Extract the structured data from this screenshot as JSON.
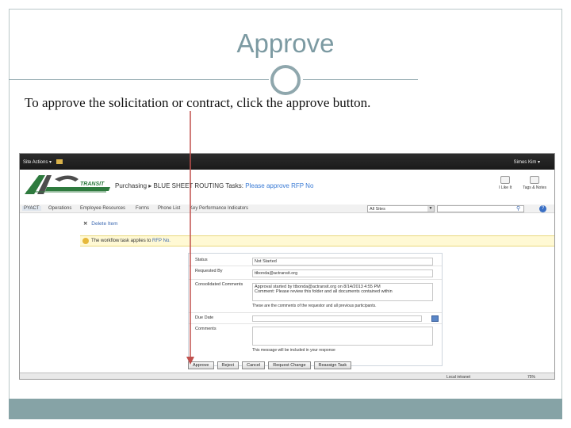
{
  "slide": {
    "title": "Approve",
    "body": "To approve the solicitation or contract, click the approve button."
  },
  "colors": {
    "title": "#7c9aa2",
    "footer": "#86a3a6",
    "arrow": "#c0504d",
    "ribbon": "#1f1f1f",
    "link": "#3a67b0",
    "info_bar": "#fff9d4"
  },
  "screenshot": {
    "ribbon": {
      "site_actions": "Site Actions ▾",
      "user": "Simes Kim ▾"
    },
    "header": {
      "logo_text": "TRANSIT",
      "breadcrumb_site": "Purchasing",
      "breadcrumb_sep": "▸",
      "breadcrumb_list": "BLUE SHEET ROUTING Tasks:",
      "breadcrumb_item": "Please approve RFP No",
      "actions": [
        "I Like It",
        "Tags & Notes"
      ]
    },
    "topnav": {
      "items": [
        "PYACT",
        "Operations",
        "Employee Resources",
        "Forms",
        "Phone List",
        "Key Performance Indicators"
      ],
      "search_scope": "All Sites"
    },
    "toolbar": {
      "delete_label": "Delete Item"
    },
    "info_bar": {
      "text": "The workflow task applies to",
      "link": "RFP No."
    },
    "form": {
      "status_label": "Status",
      "status_value": "Not Started",
      "requested_by_label": "Requested By",
      "requested_by_value": "ttbonda@actransit.org",
      "comments_label": "Consolidated Comments",
      "comments_value_1": "Approval started by ttbonda@actransit.org on 8/14/2013 4:55 PM",
      "comments_value_2": "Comment: Please review this folder and all documents contained within",
      "comments_note": "These are the comments of the requestor and all previous participants.",
      "due_date_label": "Due Date",
      "comments_field_label": "Comments",
      "comments_field_note": "This message will be included in your response"
    },
    "buttons": {
      "approve": "Approve",
      "reject": "Reject",
      "cancel": "Cancel",
      "request_change": "Request Change",
      "reassign": "Reassign Task"
    },
    "status_bar": {
      "zone": "Local intranet",
      "zoom": "75%"
    }
  }
}
